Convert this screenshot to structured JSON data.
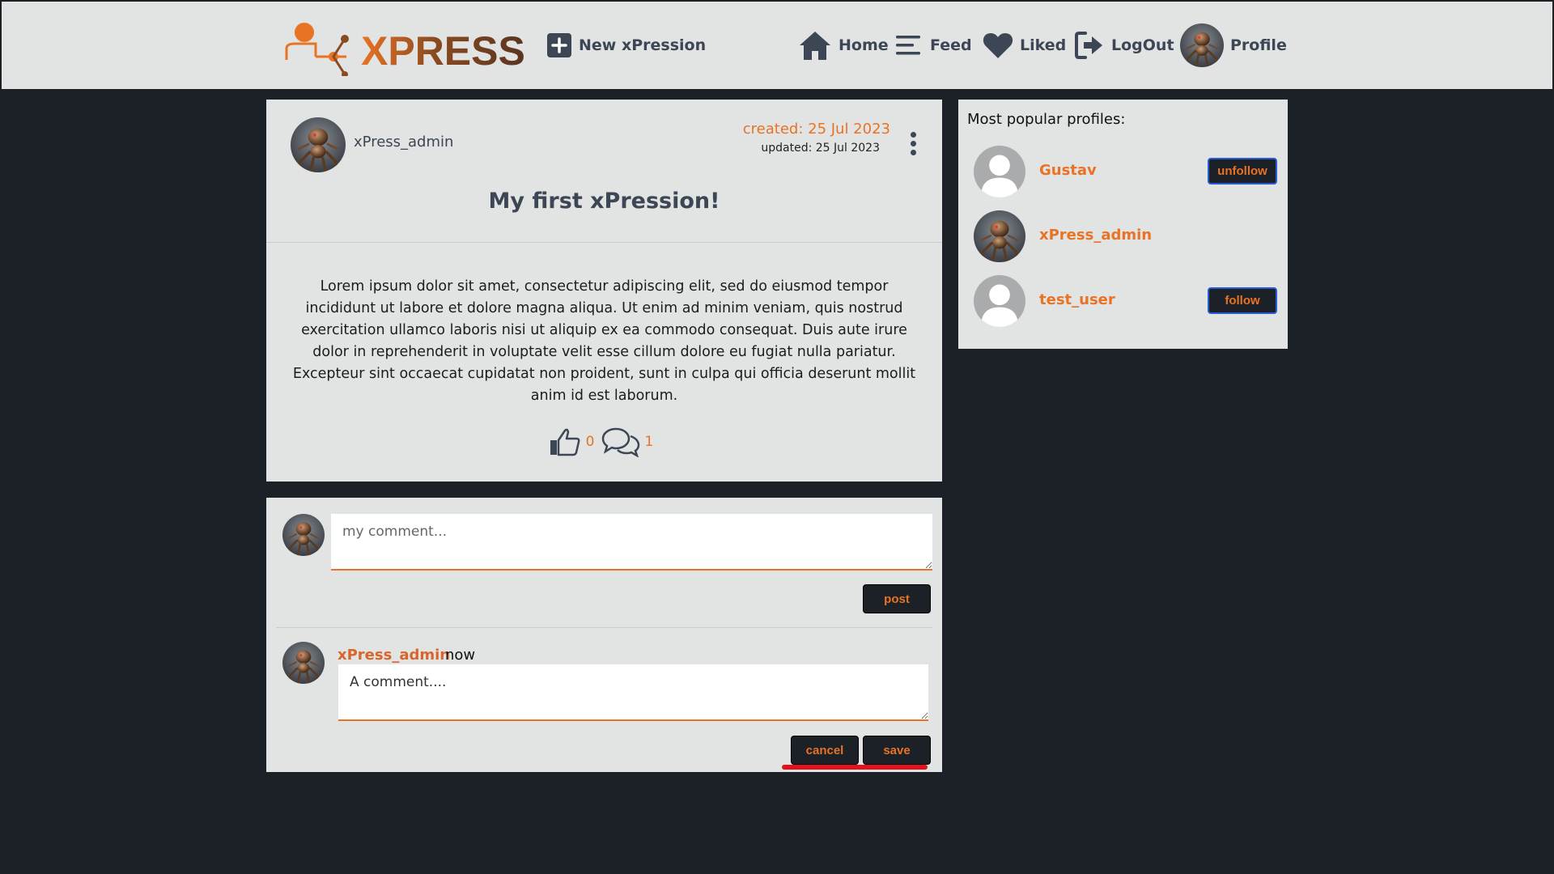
{
  "brand": {
    "name": "XPRESS",
    "accent": "#e87325",
    "background": "#1c2027",
    "panel": "#e2e4e4"
  },
  "nav": {
    "new_label": "New xPression",
    "items": [
      {
        "label": "Home",
        "icon": "home-icon"
      },
      {
        "label": "Feed",
        "icon": "feed-icon"
      },
      {
        "label": "Liked",
        "icon": "heart-icon"
      },
      {
        "label": "LogOut",
        "icon": "logout-icon"
      },
      {
        "label": "Profile",
        "icon": "avatar"
      }
    ]
  },
  "post": {
    "author": "xPress_admin",
    "created": "created: 25 Jul 2023",
    "updated": "updated: 25 Jul 2023",
    "title": "My first xPression!",
    "body": "Lorem ipsum dolor sit amet, consectetur adipiscing elit, sed do eiusmod tempor incididunt ut labore et dolore magna aliqua. Ut enim ad minim veniam, quis nostrud exercitation ullamco laboris nisi ut aliquip ex ea commodo consequat. Duis aute irure dolor in reprehenderit in voluptate velit esse cillum dolore eu fugiat nulla pariatur. Excepteur sint occaecat cupidatat non proident, sunt in culpa qui officia deserunt mollit anim id est laborum.",
    "likes": "0",
    "comments": "1"
  },
  "comment_form": {
    "placeholder": "my comment...",
    "post_label": "post"
  },
  "comments": [
    {
      "author": "xPress_admin",
      "time": "now",
      "text": "A comment....",
      "cancel_label": "cancel",
      "save_label": "save"
    }
  ],
  "sidebar": {
    "title": "Most popular profiles:",
    "profiles": [
      {
        "name": "Gustav",
        "avatar": "default-avatar",
        "action": "unfollow"
      },
      {
        "name": "xPress_admin",
        "avatar": "robot-avatar",
        "action": ""
      },
      {
        "name": "test_user",
        "avatar": "default-avatar",
        "action": "follow"
      }
    ]
  }
}
